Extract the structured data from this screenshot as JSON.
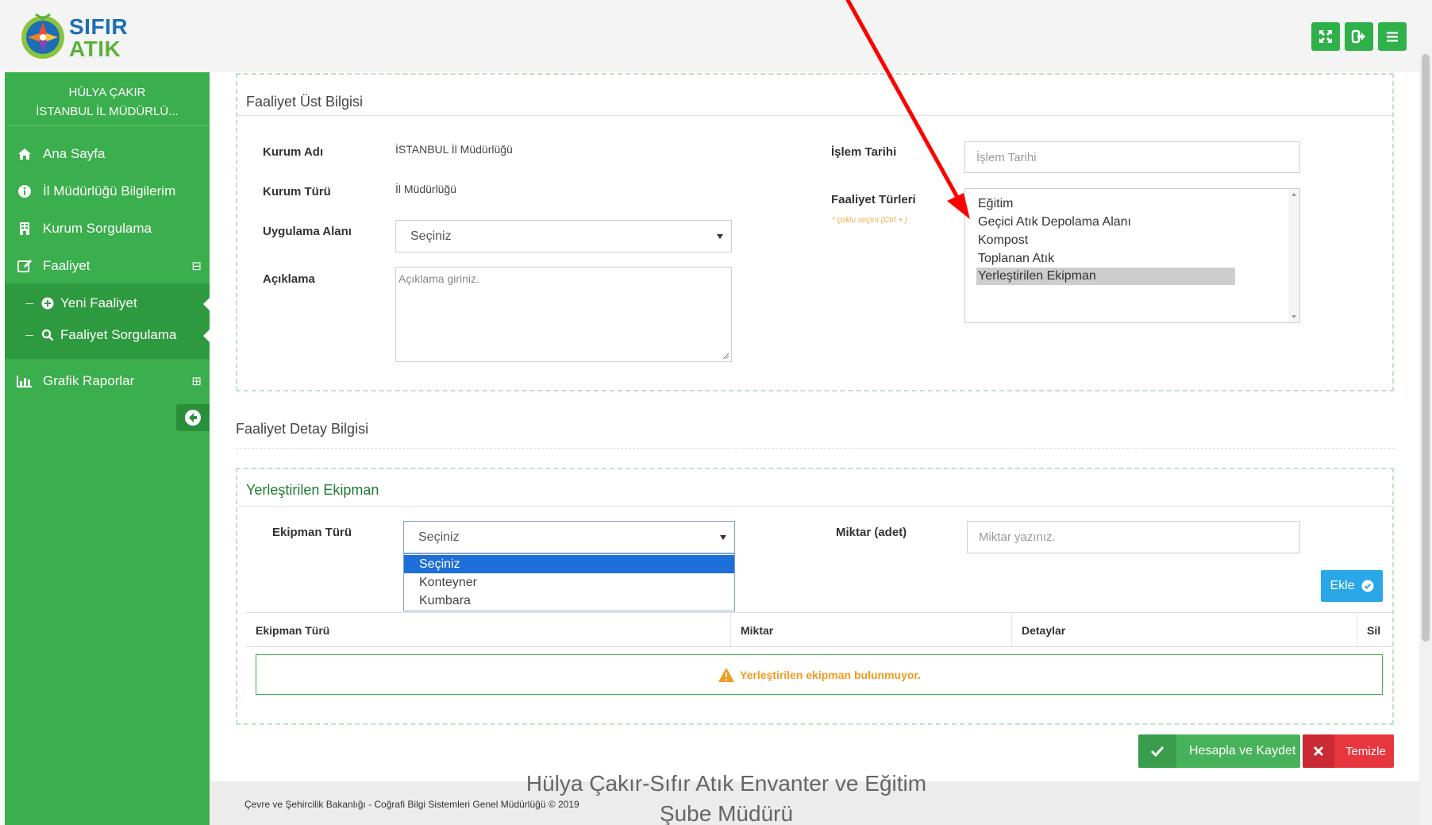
{
  "header": {
    "logo_line1": "SIFIR",
    "logo_line2": "ATIK"
  },
  "sidebar": {
    "user_name": "HÜLYA ÇAKIR",
    "user_org": "İSTANBUL İL MÜDÜRLÜ...",
    "items": [
      {
        "label": "Ana Sayfa",
        "icon": "home-icon"
      },
      {
        "label": "İl Müdürlüğü Bilgilerim",
        "icon": "info-icon"
      },
      {
        "label": "Kurum Sorgulama",
        "icon": "building-icon"
      },
      {
        "label": "Faaliyet",
        "icon": "edit-icon",
        "toggle": "⊟"
      },
      {
        "label": "Grafik Raporlar",
        "icon": "bar-chart-icon",
        "toggle": "⊞"
      }
    ],
    "sub_items": [
      {
        "label": "Yeni Faaliyet",
        "icon": "plus-circle-icon"
      },
      {
        "label": "Faaliyet Sorgulama",
        "icon": "search-icon"
      }
    ]
  },
  "form_top": {
    "title": "Faaliyet Üst Bilgisi",
    "kurum_adi_label": "Kurum Adı",
    "kurum_adi_value": "İSTANBUL İl Müdürlüğü",
    "kurum_turu_label": "Kurum Türü",
    "kurum_turu_value": "İl Müdürlüğü",
    "uygulama_label": "Uygulama Alanı",
    "uygulama_value": "Seçiniz",
    "aciklama_label": "Açıklama",
    "aciklama_placeholder": "Açıklama giriniz.",
    "islem_tarihi_label": "İşlem Tarihi",
    "islem_tarihi_placeholder": "İşlem Tarihi",
    "faaliyet_turleri_label": "Faaliyet Türleri",
    "faaliyet_turleri_hint": "* çoklu seçim (Ctrl + )",
    "faaliyet_turleri_options": [
      "Eğitim",
      "Geçici Atık Depolama Alanı",
      "Kompost",
      "Toplanan Atık",
      "Yerleştirilen Ekipman"
    ],
    "faaliyet_turleri_selected": "Yerleştirilen Ekipman"
  },
  "form_detail": {
    "title": "Faaliyet Detay Bilgisi",
    "section_title": "Yerleştirilen Ekipman",
    "ekipman_turu_label": "Ekipman Türü",
    "ekipman_turu_value": "Seçiniz",
    "ekipman_options": [
      "Seçiniz",
      "Konteyner",
      "Kumbara"
    ],
    "ekipman_active": "Seçiniz",
    "miktar_label": "Miktar (adet)",
    "miktar_placeholder": "Miktar yazınız.",
    "add_label": "Ekle",
    "table_headers": [
      "Ekipman Türü",
      "Miktar",
      "Detaylar",
      "Sil"
    ],
    "empty_message": "Yerleştirilen ekipman bulunmuyor."
  },
  "actions": {
    "save_label": "Hesapla ve Kaydet",
    "clear_label": "Temizle"
  },
  "footer": {
    "text": "Çevre ve Şehircilik Bakanlığı - Coğrafi Bilgi Sistemleri Genel Müdürlüğü © 2019",
    "watermark_line1": "Hülya Çakır-Sıfır Atık Envanter ve Eğitim",
    "watermark_line2": "Şube Müdürü"
  },
  "colors": {
    "brand_green": "#3bae4d",
    "accent_blue": "#2aa7e6",
    "danger_red": "#e8363f",
    "annotation_red": "#ff0000"
  }
}
